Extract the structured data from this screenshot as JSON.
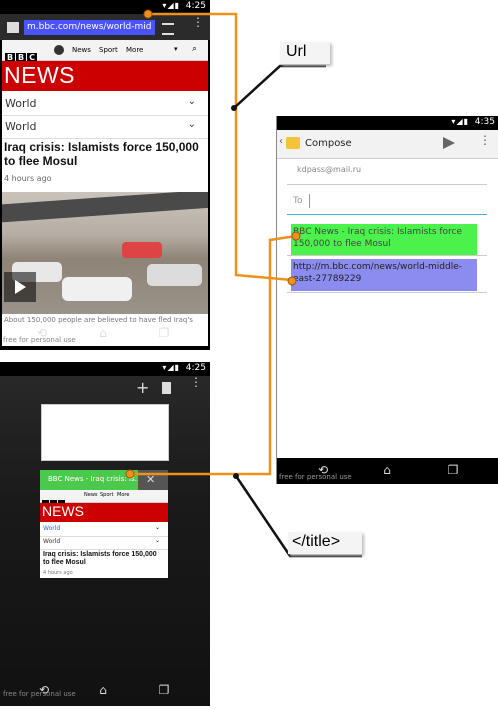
{
  "phone1": {
    "status_time": "4:25",
    "url": "m.bbc.com/news/world-mid",
    "bbc_nav": [
      "News",
      "Sport",
      "More"
    ],
    "news_banner": "NEWS",
    "world1": "World",
    "world2": "World",
    "headline": "Iraq crisis: Islamists force 150,000 to flee Mosul",
    "time_ago": "4 hours ago",
    "caption": "About 150,000 people are believed to have fled Iraq's",
    "watermark": "free for personal use"
  },
  "phone2": {
    "status_time": "4:35",
    "title": "Compose",
    "from": "kdpass@mail.ru",
    "to_label": "To",
    "subject": "BBC News - Iraq crisis: Islamists force 150,000 to flee Mosul",
    "body": "http://m.bbc.com/news/world-middle-east-27789229",
    "watermark": "free for personal use"
  },
  "phone3": {
    "status_time": "4:25",
    "tab_title": "BBC News - Iraq crisis: Is...",
    "bbc_nav": [
      "News",
      "Sport",
      "More"
    ],
    "news_banner": "NEWS",
    "world1": "World",
    "world2": "World",
    "headline": "Iraq crisis: Islamists force 150,000 to flee Mosul",
    "time_ago": "4 hours ago",
    "watermark": "free for personal use"
  },
  "labels": {
    "url": "Url",
    "title": "</title>"
  },
  "colors": {
    "bbc_red": "#cc0000",
    "highlight_blue": "#4a53ff",
    "highlight_green": "#4cf24c",
    "highlight_purple": "#8b8bf0",
    "connector_orange": "#f0901c"
  }
}
